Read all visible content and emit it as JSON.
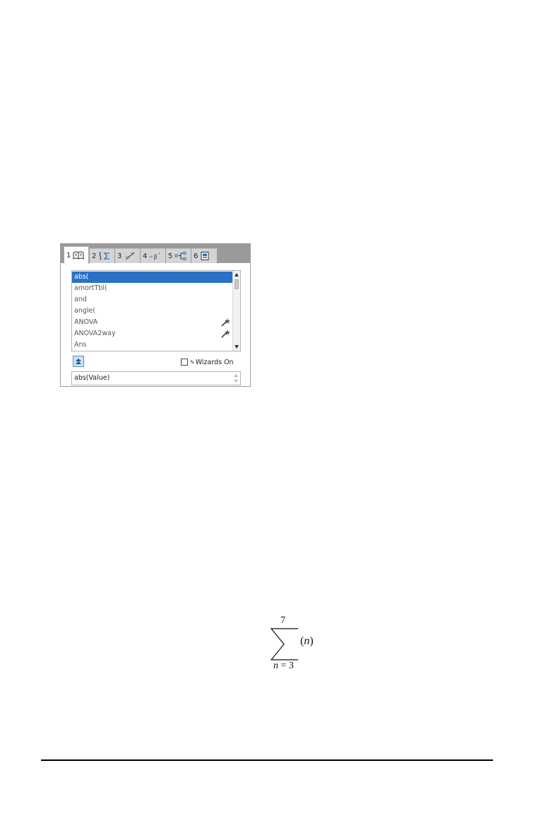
{
  "catalog": {
    "tabs": [
      {
        "num": "1",
        "icon": "book-icon"
      },
      {
        "num": "2",
        "icon": "integral-sigma-icon"
      },
      {
        "num": "3",
        "icon": "unit-conversion-icon"
      },
      {
        "num": "4",
        "icon": "symbols-icon"
      },
      {
        "num": "5",
        "icon": "templates-icon"
      },
      {
        "num": "6",
        "icon": "library-icon"
      }
    ],
    "items": [
      {
        "label": "abs(",
        "selected": true,
        "wizard": false
      },
      {
        "label": "amortTbl(",
        "selected": false,
        "wizard": false
      },
      {
        "label": "and",
        "selected": false,
        "wizard": false
      },
      {
        "label": "angle(",
        "selected": false,
        "wizard": false
      },
      {
        "label": "ANOVA",
        "selected": false,
        "wizard": true
      },
      {
        "label": "ANOVA2way",
        "selected": false,
        "wizard": true
      },
      {
        "label": "Ans",
        "selected": false,
        "wizard": false
      }
    ],
    "wizards_label": "Wizards On",
    "wizards_checked": false,
    "syntax": "abs(Value)",
    "colors": {
      "selection": "#2a70c8",
      "tabbar": "#9a9a9a"
    }
  },
  "formula": {
    "upper": "7",
    "lower_var": "n",
    "lower_eq": " = 3",
    "term_open": "(",
    "term_var": "n",
    "term_close": ")"
  }
}
